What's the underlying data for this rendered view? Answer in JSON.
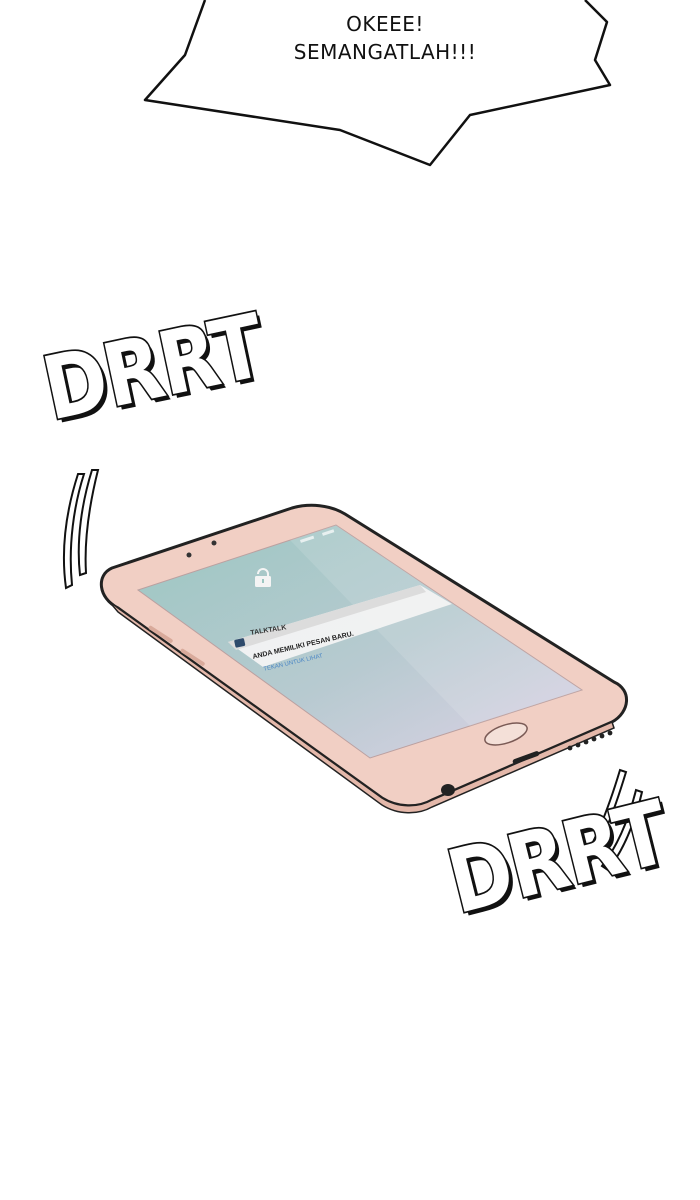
{
  "speech_bubble": {
    "line1": "OKEEE!",
    "line2": "SEMANGATLAH!!!"
  },
  "sound_effects": {
    "top": "DRRT",
    "bottom": "DRRT"
  },
  "phone": {
    "body_color": "#f1cfc4",
    "screen_top_color": "#9cc7c2",
    "screen_bottom_color": "#ddd2e6",
    "lock_icon": "lock-icon",
    "notification": {
      "app_name": "TALKTALK",
      "message": "ANDA MEMILIKI PESAN BARU.",
      "hint": "TEKAN UNTUK LIHAT"
    }
  }
}
